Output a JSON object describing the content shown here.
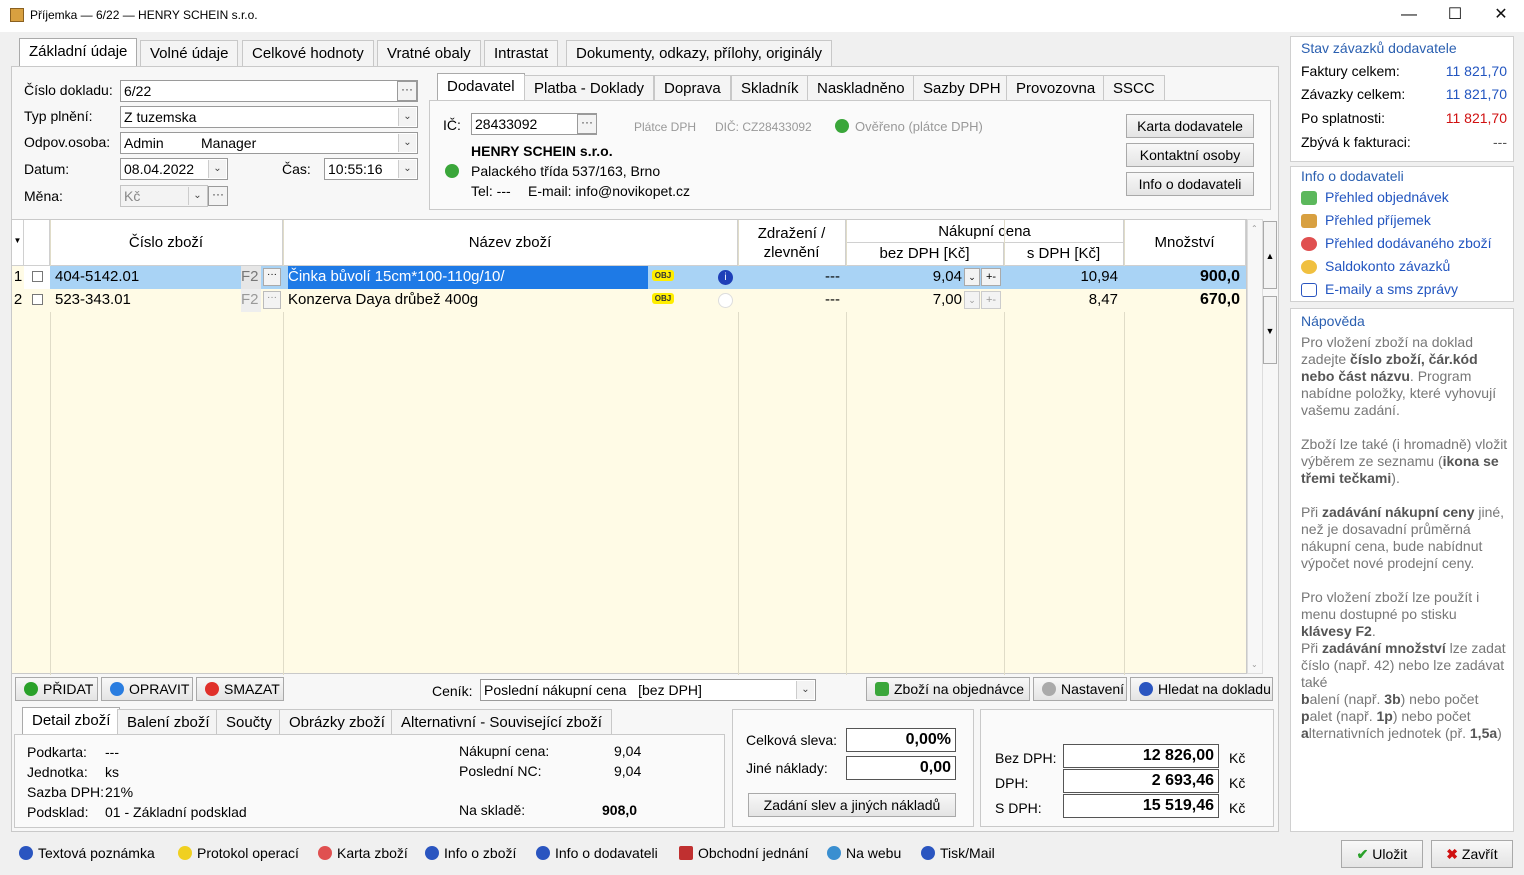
{
  "window": {
    "title": "Příjemka — 6/22 — HENRY SCHEIN s.r.o."
  },
  "main_tabs": [
    "Základní údaje",
    "Volné údaje",
    "Celkové hodnoty",
    "Vratné obaly",
    "Intrastat",
    "Dokumenty, odkazy, přílohy, originály"
  ],
  "header": {
    "doc_no_label": "Číslo dokladu:",
    "doc_no": "6/22",
    "type_label": "Typ plnění:",
    "type": "Z tuzemska",
    "person_label": "Odpov.osoba:",
    "person_name": "Admin",
    "person_role": "Manager",
    "date_label": "Datum:",
    "date": "08.04.2022",
    "time_label": "Čas:",
    "time": "10:55:16",
    "currency_label": "Měna:",
    "currency": "Kč"
  },
  "supplier_tabs": [
    "Dodavatel",
    "Platba - Doklady",
    "Doprava",
    "Skladník",
    "Naskladněno",
    "Sazby DPH",
    "Provozovna",
    "SSCC"
  ],
  "supplier": {
    "ic_label": "IČ:",
    "ic": "28433092",
    "vat_payer": "Plátce DPH",
    "dic": "DIČ: CZ28433092",
    "verified": "Ověřeno (plátce DPH)",
    "name": "HENRY SCHEIN s.r.o.",
    "address": "Palackého třída 537/163,  Brno",
    "tel": "Tel: ---",
    "email": "E-mail: info@novikopet.cz",
    "btn_card": "Karta dodavatele",
    "btn_contacts": "Kontaktní osoby",
    "btn_info": "Info o dodavateli"
  },
  "grid": {
    "col_code": "Číslo zboží",
    "col_name": "Název zboží",
    "col_markup": "Zdražení /\nzlevnění",
    "col_price": "Nákupní cena",
    "col_price_net": "bez DPH [Kč]",
    "col_price_gross": "s DPH [Kč]",
    "col_qty": "Množství",
    "rows": [
      {
        "n": "1",
        "code": "404-5142.01",
        "f2": "F2",
        "name": "Činka bůvolí 15cm*100-110g/10/",
        "obj": "OBJ",
        "markup": "---",
        "net": "9,04",
        "pm": "+-",
        "gross": "10,94",
        "qty": "900,0"
      },
      {
        "n": "2",
        "code": "523-343.01",
        "f2": "F2",
        "name": "Konzerva Daya drůbež 400g",
        "obj": "OBJ",
        "markup": "---",
        "net": "7,00",
        "pm": "+-",
        "gross": "8,47",
        "qty": "670,0"
      }
    ]
  },
  "toolbar": {
    "add": "PŘIDAT",
    "edit": "OPRAVIT",
    "delete": "SMAZAT",
    "pricelist_label": "Ceník:",
    "pricelist": "Poslední nákupní cena   [bez DPH]",
    "on_order": "Zboží na objednávce",
    "settings": "Nastavení",
    "find": "Hledat na dokladu"
  },
  "detail_tabs": [
    "Detail zboží",
    "Balení zboží",
    "Součty",
    "Obrázky zboží",
    "Alternativní - Související zboží"
  ],
  "detail": {
    "subcard_label": "Podkarta:",
    "subcard": "---",
    "unit_label": "Jednotka:",
    "unit": "ks",
    "vat_label": "Sazba DPH:",
    "vat": "21%",
    "substock_label": "Podsklad:",
    "substock": "01 - Základní podsklad",
    "buy_label": "Nákupní cena:",
    "buy": "9,04",
    "last_label": "Poslední NC:",
    "last": "9,04",
    "stock_label": "Na skladě:",
    "stock": "908,0"
  },
  "discount": {
    "total_label": "Celková sleva:",
    "total": "0,00%",
    "other_label": "Jiné náklady:",
    "other": "0,00",
    "btn": "Zadání slev a jiných nákladů"
  },
  "totals": {
    "net_label": "Bez DPH:",
    "net": "12 826,00",
    "vat_label": "DPH:",
    "vat": "2 693,46",
    "gross_label": "S DPH:",
    "gross": "15 519,46",
    "currency": "Kč"
  },
  "side_status": {
    "title": "Stav závazků dodavatele",
    "invoices_label": "Faktury celkem:",
    "invoices": "11 821,70",
    "liabilities_label": "Závazky celkem:",
    "liabilities": "11 821,70",
    "overdue_label": "Po splatnosti:",
    "overdue": "11 821,70",
    "remaining_label": "Zbývá k fakturaci:",
    "remaining": "---"
  },
  "side_info": {
    "title": "Info o dodavateli",
    "links": [
      "Přehled objednávek",
      "Přehled příjemek",
      "Přehled dodávaného zboží",
      "Saldokonto závazků",
      "E-maily a sms zprávy"
    ]
  },
  "help": {
    "title": "Nápověda",
    "p1a": "Pro vložení zboží na doklad zadejte ",
    "p1b": "číslo zboží, čár.kód nebo část názvu",
    "p1c": ". Program nabídne položky, které vyhovují vašemu zadání.",
    "p2a": "Zboží lze také (i hromadně) vložit výběrem ze seznamu (",
    "p2b": "ikona se třemi tečkami",
    "p2c": ").",
    "p3a": "Při ",
    "p3b": "zadávání nákupní ceny",
    "p3c": " jiné, než je dosavadní průměrná nákupní cena, bude nabídnut výpočet nové prodejní ceny.",
    "p4a": "Pro vložení zboží lze použít i menu dostupné po stisku ",
    "p4b": "klávesy F2",
    "p4c": ".",
    "p5a": "Při ",
    "p5b": "zadávání množství",
    "p5c": " lze zadat číslo (např. 42) nebo lze zadávat také",
    "p5d": "b",
    "p5e": "alení (např. ",
    "p5f": "3b",
    "p5g": ") nebo počet",
    "p5h": "p",
    "p5i": "alet (např. ",
    "p5j": "1p",
    "p5k": ") nebo počet",
    "p5l": "a",
    "p5m": "lternativních jednotek (př. ",
    "p5n": "1,5a",
    "p5o": ")"
  },
  "bottom": {
    "note": "Textová poznámka",
    "protocol": "Protokol operací",
    "card": "Karta zboží",
    "goods_info": "Info o zboží",
    "supplier_info": "Info o dodavateli",
    "business": "Obchodní jednání",
    "web": "Na webu",
    "print": "Tisk/Mail",
    "save": "Uložit",
    "close": "Zavřít"
  }
}
